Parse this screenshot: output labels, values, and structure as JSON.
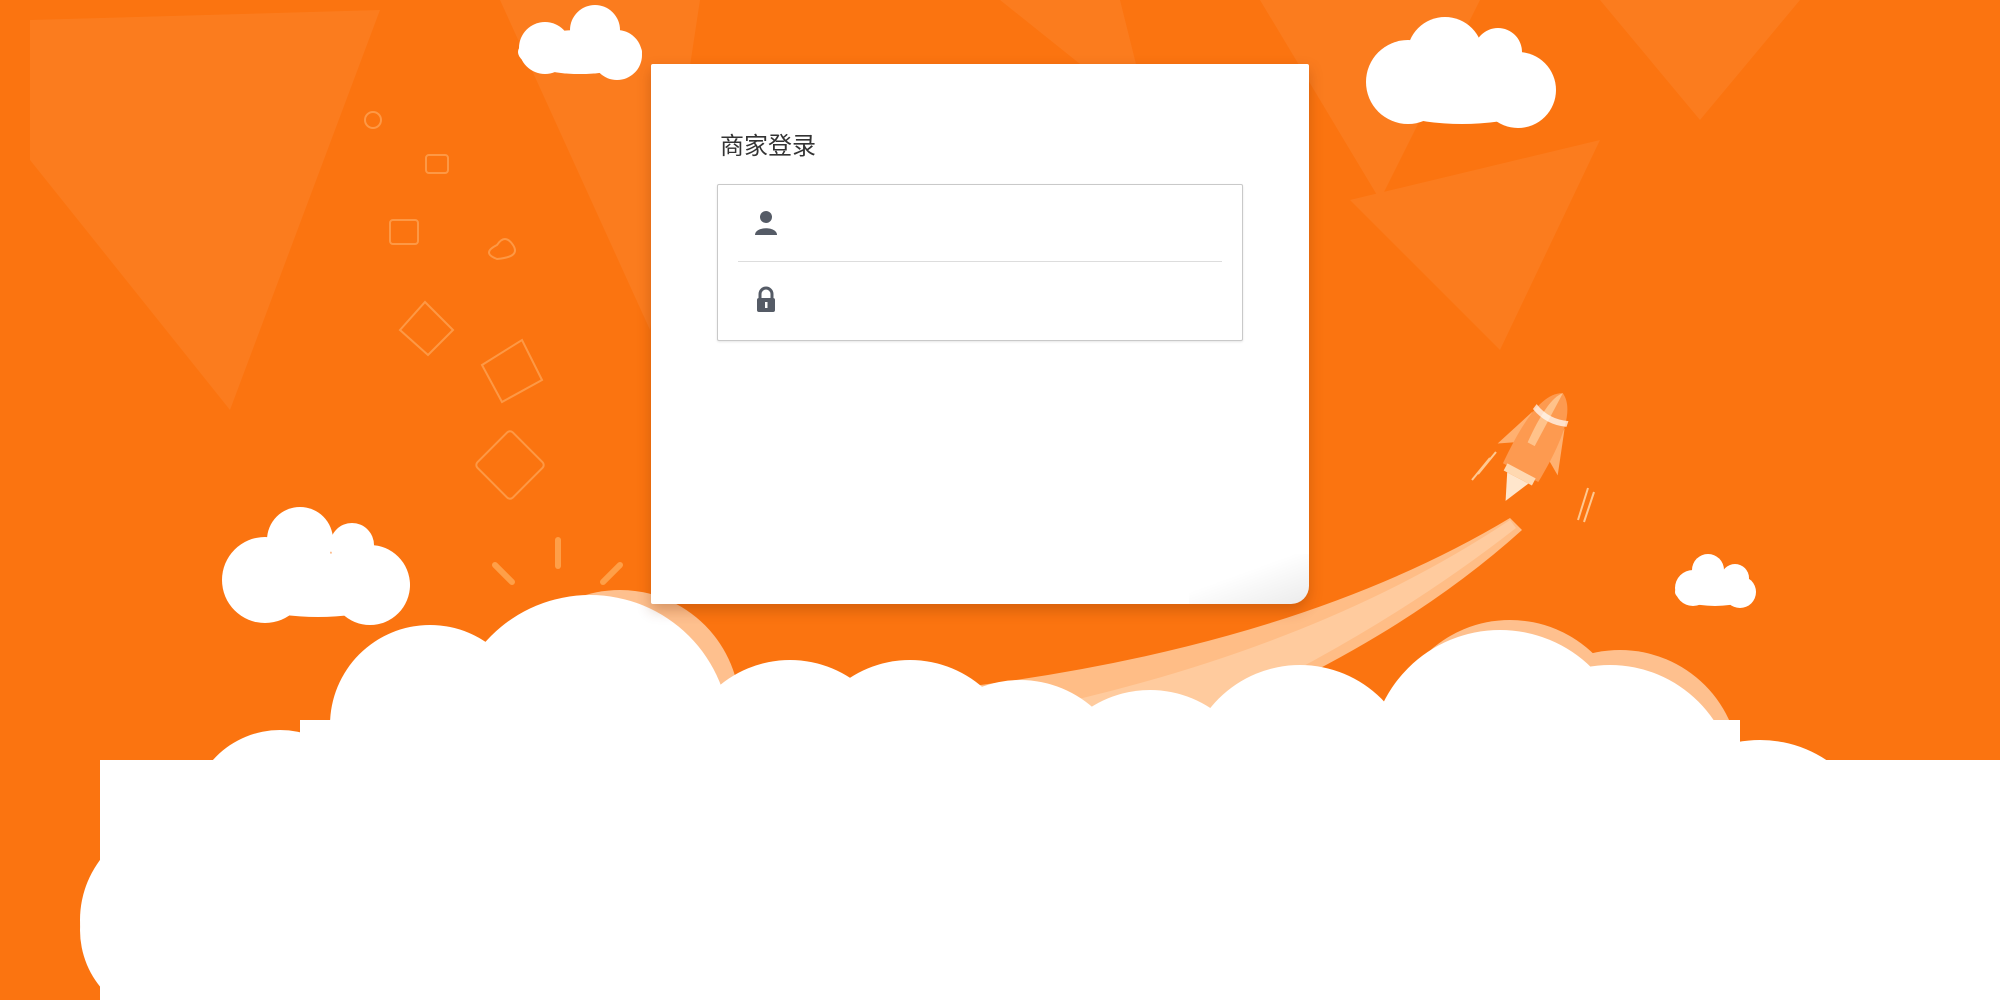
{
  "colors": {
    "background": "#fb7410",
    "card": "#ffffff",
    "cloud": "#ffffff",
    "rocket": "#fd9a50",
    "trail": "#ffbd86"
  },
  "login": {
    "title": "商家登录",
    "username": {
      "icon": "user-icon",
      "placeholder": "",
      "value": ""
    },
    "password": {
      "icon": "lock-icon",
      "placeholder": "",
      "value": ""
    }
  }
}
